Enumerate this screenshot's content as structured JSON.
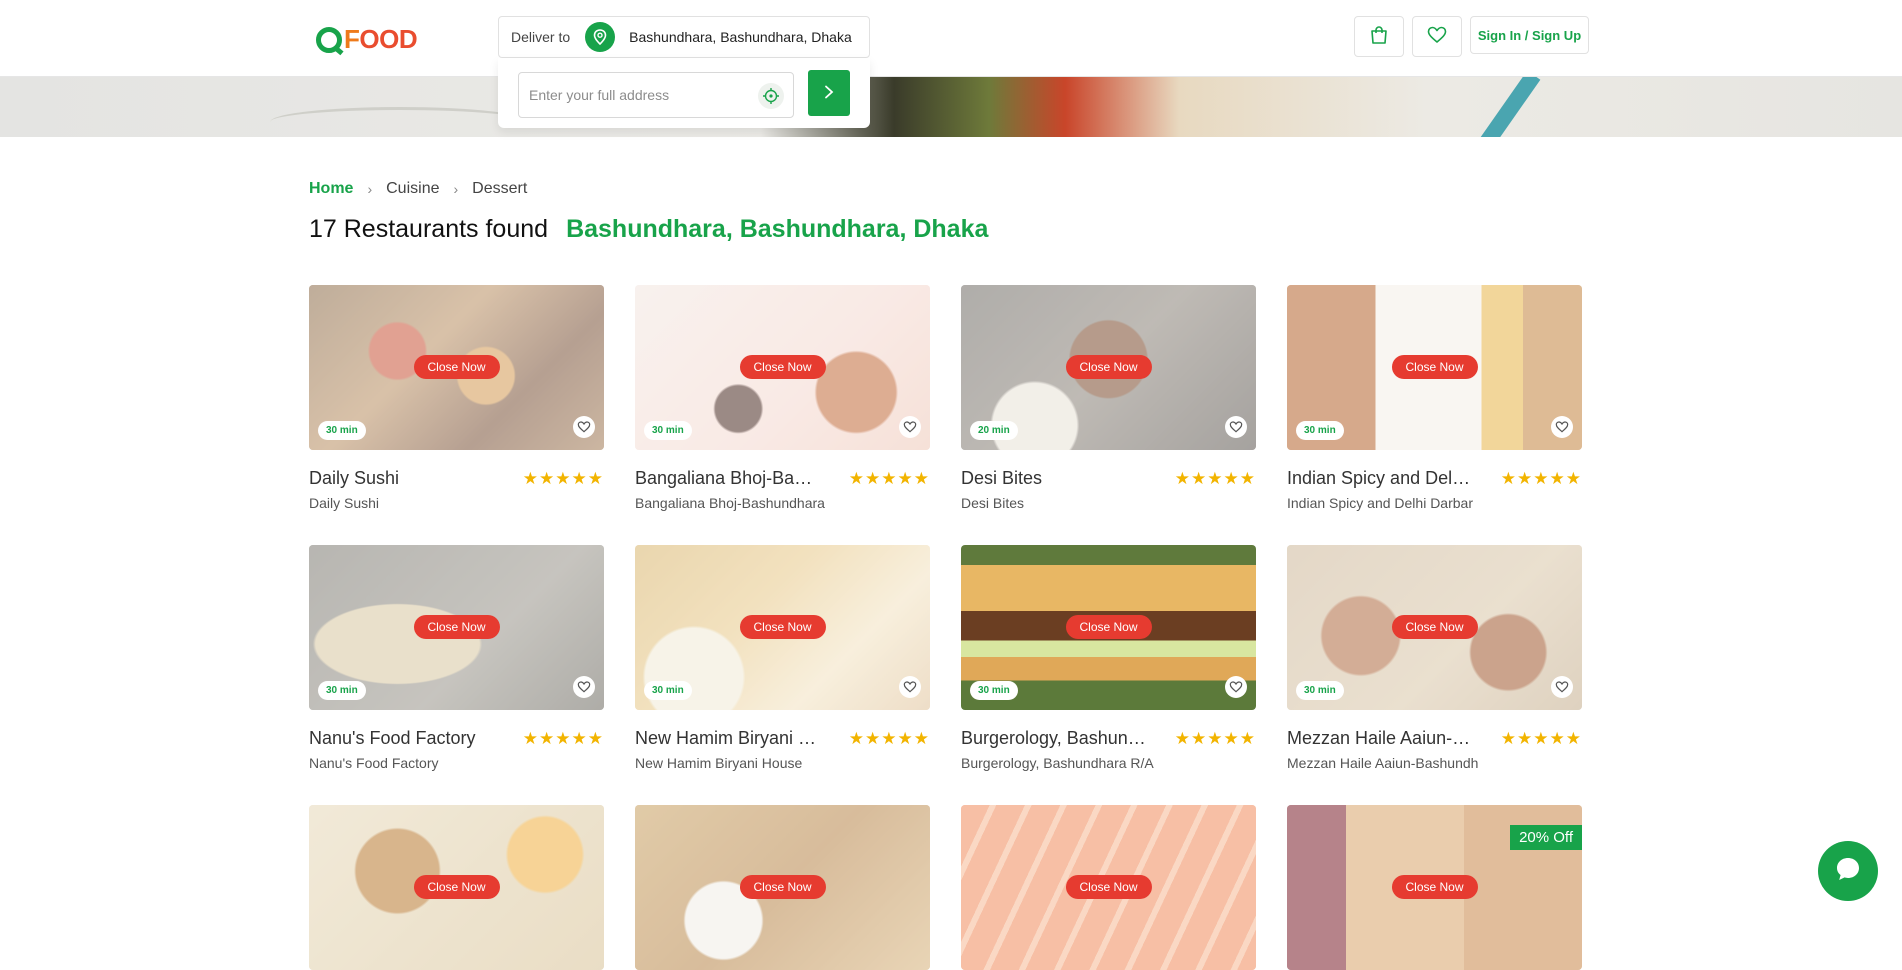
{
  "brand": {
    "logo_text": "QFOOD"
  },
  "header": {
    "deliver_label": "Deliver to",
    "address": "Bashundhara, Bashundhara, Dhaka",
    "address_input_placeholder": "Enter your full address",
    "signin_label": "Sign In / Sign Up"
  },
  "breadcrumb": {
    "home": "Home",
    "level1": "Cuisine",
    "level2": "Dessert"
  },
  "results": {
    "count_text": "17 Restaurants found",
    "location": "Bashundhara, Bashundhara, Dhaka"
  },
  "cards": [
    {
      "title": "Daily Sushi",
      "subtitle": "Daily Sushi",
      "status": "Close Now",
      "time": "30 min",
      "rating": "★★★★★"
    },
    {
      "title": "Bangaliana Bhoj-Bash...",
      "subtitle": "Bangaliana Bhoj-Bashundhara",
      "status": "Close Now",
      "time": "30 min",
      "rating": "★★★★★"
    },
    {
      "title": "Desi Bites",
      "subtitle": "Desi Bites",
      "status": "Close Now",
      "time": "20 min",
      "rating": "★★★★★"
    },
    {
      "title": "Indian Spicy and Delhi...",
      "subtitle": "Indian Spicy and Delhi Darbar",
      "status": "Close Now",
      "time": "30 min",
      "rating": "★★★★★"
    },
    {
      "title": "Nanu's Food Factory",
      "subtitle": "Nanu's Food Factory",
      "status": "Close Now",
      "time": "30 min",
      "rating": "★★★★★"
    },
    {
      "title": "New Hamim Biryani H...",
      "subtitle": "New Hamim Biryani House",
      "status": "Close Now",
      "time": "30 min",
      "rating": "★★★★★"
    },
    {
      "title": "Burgerology, Bashund...",
      "subtitle": "Burgerology, Bashundhara R/A",
      "status": "Close Now",
      "time": "30 min",
      "rating": "★★★★★"
    },
    {
      "title": "Mezzan Haile Aaiun-B...",
      "subtitle": "Mezzan Haile Aaiun-Bashundh",
      "status": "Close Now",
      "time": "30 min",
      "rating": "★★★★★"
    },
    {
      "status": "Close Now"
    },
    {
      "status": "Close Now"
    },
    {
      "status": "Close Now"
    },
    {
      "status": "Close Now",
      "offer": "20% Off"
    }
  ],
  "colors": {
    "accent": "#18a34a",
    "closed": "#e63b30",
    "star": "#f2b400"
  },
  "icons": [
    "location-pin-icon",
    "locate-icon",
    "chevron-right-icon",
    "shopping-bag-icon",
    "heart-icon",
    "chat-icon"
  ]
}
